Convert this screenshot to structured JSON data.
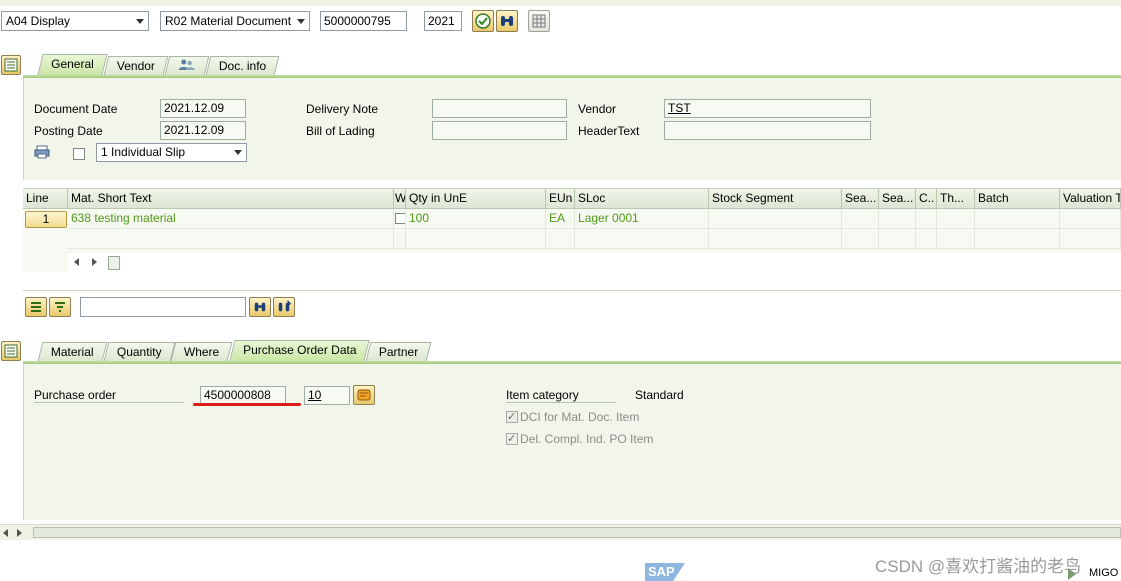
{
  "toolbar": {
    "action": "A04 Display",
    "reference": "R02 Material Document",
    "doc_number": "5000000795",
    "year": "2021"
  },
  "header_tabs": [
    "General",
    "Vendor",
    "",
    "Doc. info"
  ],
  "general": {
    "document_date_label": "Document Date",
    "document_date": "2021.12.09",
    "posting_date_label": "Posting Date",
    "posting_date": "2021.12.09",
    "slip_option": "1 Individual Slip",
    "delivery_note_label": "Delivery Note",
    "delivery_note": "",
    "bill_of_lading_label": "Bill of Lading",
    "bill_of_lading": "",
    "vendor_label": "Vendor",
    "vendor": "TST",
    "header_text_label": "HeaderText",
    "header_text": ""
  },
  "items_table": {
    "columns": [
      "Line",
      "Mat. Short Text",
      "W",
      "Qty in UnE",
      "EUn",
      "SLoc",
      "Stock Segment",
      "Sea...",
      "Sea...",
      "C..",
      "Th...",
      "Batch",
      "Valuation T"
    ],
    "rows": [
      {
        "line": "1",
        "mat_short_text": "638 testing material",
        "qty": "100",
        "eun": "EA",
        "sloc": "Lager 0001"
      }
    ]
  },
  "search": {
    "value": ""
  },
  "detail_tabs": [
    "Material",
    "Quantity",
    "Where",
    "Purchase Order Data",
    "Partner"
  ],
  "po_data": {
    "purchase_order_label": "Purchase order",
    "purchase_order": "4500000808",
    "po_item": "10",
    "item_category_label": "Item category",
    "item_category": "Standard",
    "dci_label": "DCI for Mat. Doc. Item",
    "del_compl_label": "Del. Compl. Ind. PO Item"
  },
  "footer": {
    "sap_logo": "SAP",
    "watermark": "CSDN @喜欢打酱油的老鸟",
    "tcode": "MIGO"
  },
  "colors": {
    "green_text": "#4f9a16",
    "annotation_red": "#d91c1c",
    "tab_active": "#c9e6a6"
  }
}
